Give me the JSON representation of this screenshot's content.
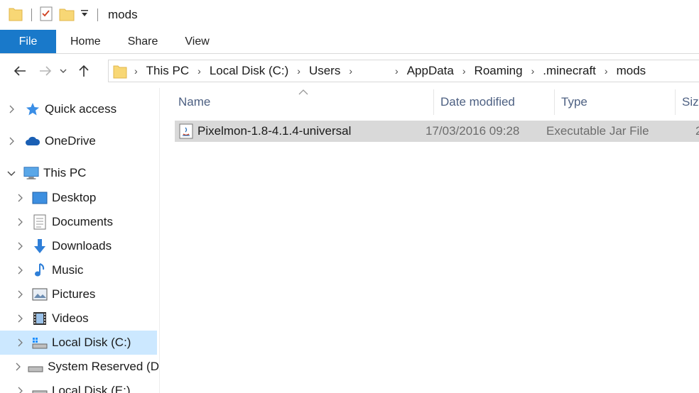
{
  "window": {
    "title": "mods"
  },
  "ribbon": {
    "tabs": [
      "File",
      "Home",
      "Share",
      "View"
    ]
  },
  "address": {
    "crumbs": [
      "This PC",
      "Local Disk (C:)",
      "Users",
      "",
      "AppData",
      "Roaming",
      ".minecraft",
      "mods"
    ]
  },
  "navpane": {
    "items": [
      {
        "label": "Quick access",
        "icon": "star-icon"
      },
      {
        "label": "OneDrive",
        "icon": "cloud-icon"
      },
      {
        "label": "This PC",
        "icon": "computer-icon"
      },
      {
        "label": "Desktop",
        "icon": "desktop-icon"
      },
      {
        "label": "Documents",
        "icon": "document-icon"
      },
      {
        "label": "Downloads",
        "icon": "download-icon"
      },
      {
        "label": "Music",
        "icon": "music-icon"
      },
      {
        "label": "Pictures",
        "icon": "picture-icon"
      },
      {
        "label": "Videos",
        "icon": "video-icon"
      },
      {
        "label": "Local Disk (C:)",
        "icon": "drive-icon",
        "selected": true
      },
      {
        "label": "System Reserved (D",
        "icon": "drive-icon"
      },
      {
        "label": "Local Disk (E:)",
        "icon": "drive-icon"
      }
    ]
  },
  "filelist": {
    "columns": {
      "name": "Name",
      "date": "Date modified",
      "type": "Type",
      "size": "Size"
    },
    "rows": [
      {
        "name": "Pixelmon-1.8-4.1.4-universal",
        "date": "17/03/2016 09:28",
        "type": "Executable Jar File",
        "size": "2"
      }
    ]
  },
  "colors": {
    "accent": "#1979ca",
    "selection": "#cce8ff",
    "row_highlight": "#d9d9d9",
    "header_text": "#4d6082"
  }
}
